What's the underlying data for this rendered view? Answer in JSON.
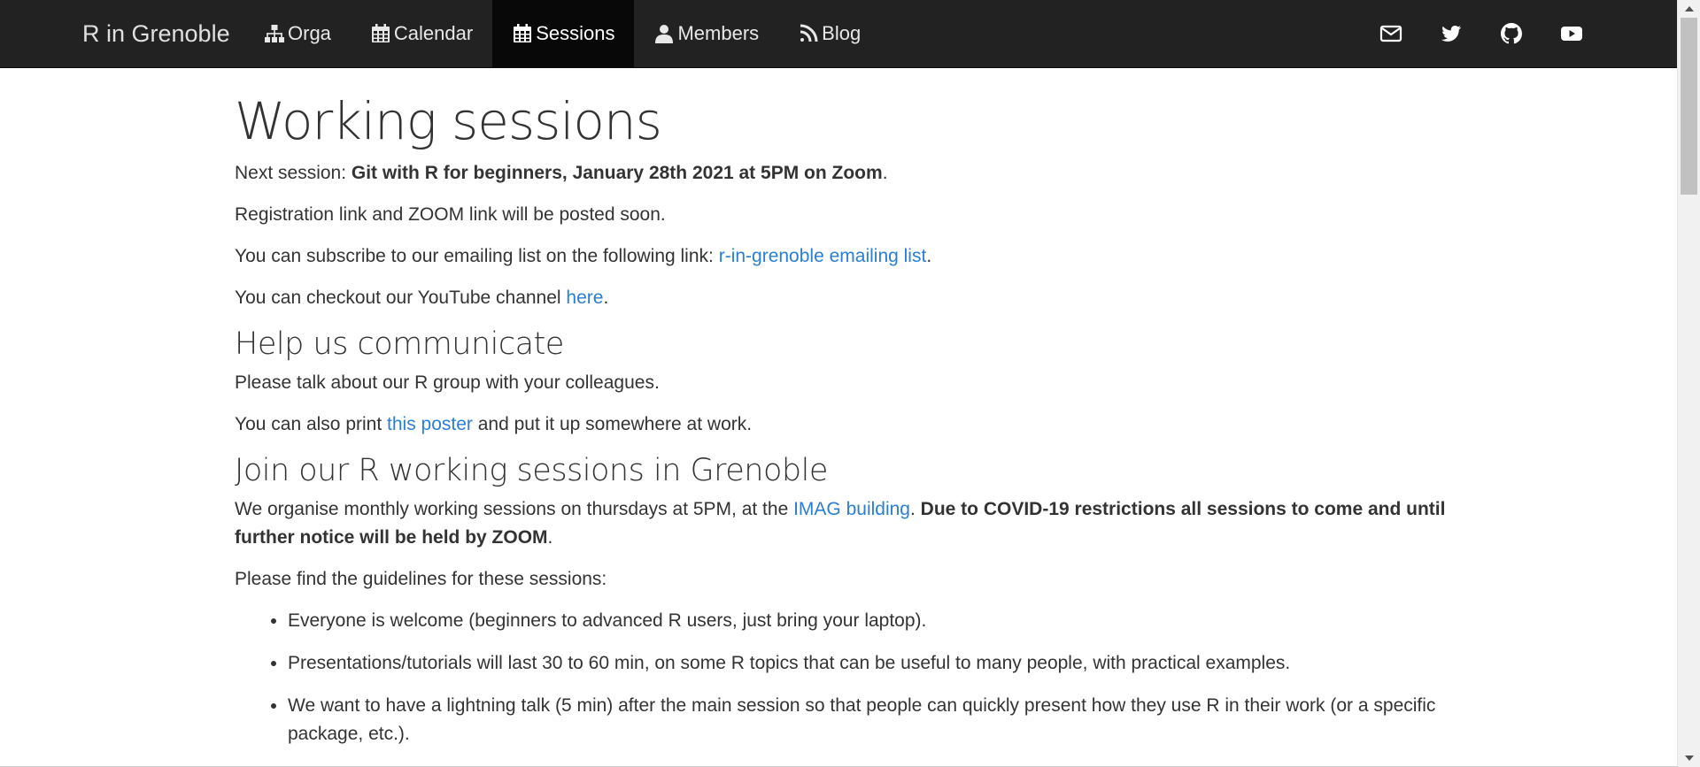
{
  "navbar": {
    "brand": "R in Grenoble",
    "items": [
      {
        "label": "Orga",
        "icon": "sitemap-icon",
        "active": false
      },
      {
        "label": "Calendar",
        "icon": "calendar-icon",
        "active": false
      },
      {
        "label": "Sessions",
        "icon": "calendar-icon",
        "active": true
      },
      {
        "label": "Members",
        "icon": "user-icon",
        "active": false
      },
      {
        "label": "Blog",
        "icon": "rss-icon",
        "active": false
      }
    ],
    "social": [
      "envelope-icon",
      "twitter-icon",
      "github-icon",
      "youtube-icon"
    ],
    "colors": {
      "background": "#222222",
      "active": "#080808",
      "text": "#e8e8e8"
    }
  },
  "page": {
    "title": "Working sessions",
    "next_session": {
      "prefix": "Next session: ",
      "bold": "Git with R for beginners, January 28th 2021 at 5PM on Zoom",
      "suffix": "."
    },
    "registration": "Registration link and ZOOM link will be posted soon.",
    "subscribe": {
      "prefix": "You can subscribe to our emailing list on the following link: ",
      "link": "r-in-grenoble emailing list",
      "suffix": "."
    },
    "youtube": {
      "prefix": "You can checkout our YouTube channel ",
      "link": "here",
      "suffix": "."
    },
    "section_communicate": {
      "heading": "Help us communicate",
      "p1": "Please talk about our R group with your colleagues.",
      "p2_prefix": "You can also print ",
      "p2_link": "this poster",
      "p2_suffix": " and put it up somewhere at work."
    },
    "section_join": {
      "heading": "Join our R working sessions in Grenoble",
      "p1_prefix": "We organise monthly working sessions on thursdays at 5PM, at the ",
      "p1_link": "IMAG building",
      "p1_mid": ". ",
      "p1_bold": "Due to COVID-19 restrictions all sessions to come and until further notice will be held by ZOOM",
      "p1_suffix": ".",
      "guidelines_intro": "Please find the guidelines for these sessions:",
      "guidelines": [
        "Everyone is welcome (beginners to advanced R users, just bring your laptop).",
        "Presentations/tutorials will last 30 to 60 min, on some R topics that can be useful to many people, with practical examples.",
        "We want to have a lightning talk (5 min) after the main session so that people can quickly present how they use R in their work (or a specific package, etc.)."
      ]
    },
    "link_color": "#2a7ed6"
  }
}
